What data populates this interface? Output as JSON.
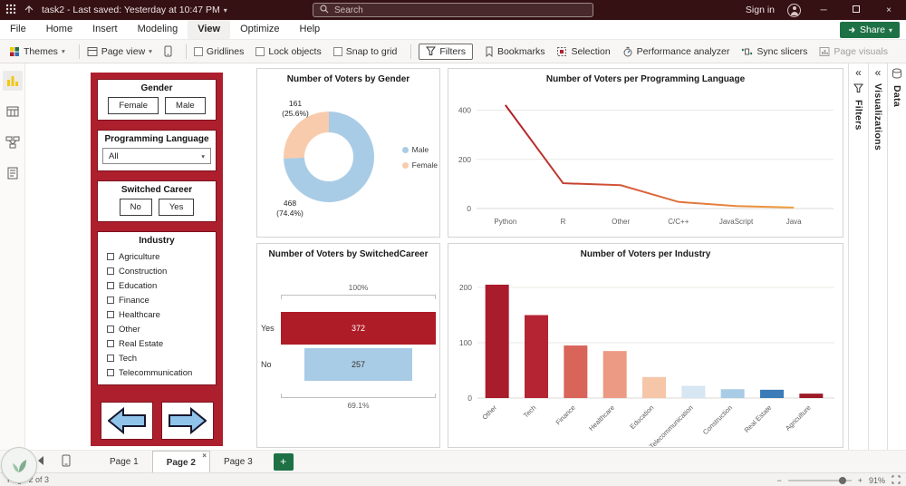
{
  "titlebar": {
    "title": "task2 - Last saved: Yesterday at 10:47 PM",
    "search_placeholder": "Search",
    "sign_in": "Sign in"
  },
  "menubar": {
    "items": [
      "File",
      "Home",
      "Insert",
      "Modeling",
      "View",
      "Optimize",
      "Help"
    ],
    "share": "Share"
  },
  "ribbon": {
    "themes": "Themes",
    "page_view": "Page view",
    "gridlines": "Gridlines",
    "lock_objects": "Lock objects",
    "snap_to_grid": "Snap to grid",
    "filters": "Filters",
    "bookmarks": "Bookmarks",
    "selection": "Selection",
    "performance_analyzer": "Performance analyzer",
    "sync_slicers": "Sync slicers",
    "page_visuals": "Page visuals"
  },
  "slicers": {
    "gender": {
      "title": "Gender",
      "options": [
        "Female",
        "Male"
      ]
    },
    "language": {
      "title": "Programming Language",
      "value": "All"
    },
    "switched": {
      "title": "Switched Career",
      "options": [
        "No",
        "Yes"
      ]
    },
    "industry": {
      "title": "Industry",
      "options": [
        "Agriculture",
        "Construction",
        "Education",
        "Finance",
        "Healthcare",
        "Other",
        "Real Estate",
        "Tech",
        "Telecommunication"
      ]
    }
  },
  "chart_data": [
    {
      "type": "pie",
      "title": "Number of Voters by Gender",
      "labels": [
        "Male",
        "Female"
      ],
      "values": [
        468,
        161
      ],
      "percent_labels": [
        "(74.4%)",
        "(25.6%)"
      ],
      "colors": [
        "#A9CCE6",
        "#F8CBAD"
      ],
      "legend_position": "right"
    },
    {
      "type": "line",
      "title": "Number of Voters per Programming Language",
      "categories": [
        "Python",
        "R",
        "Other",
        "C/C++",
        "JavaScript",
        "Java"
      ],
      "values": [
        421,
        103,
        95,
        27,
        10,
        4
      ],
      "ylim": [
        0,
        450
      ],
      "yticks": [
        0,
        200,
        400
      ],
      "line_colors": [
        "#B01E24",
        "#D95F3B",
        "#F2A03D"
      ]
    },
    {
      "type": "funnel",
      "title": "Number of Voters by SwitchedCareer",
      "categories": [
        "Yes",
        "No"
      ],
      "values": [
        372,
        257
      ],
      "colors": [
        "#AE1C28",
        "#A9CCE6"
      ],
      "top_label": "100%",
      "bottom_label": "69.1%"
    },
    {
      "type": "bar",
      "title": "Number of Voters per Industry",
      "categories": [
        "Other",
        "Tech",
        "Finance",
        "Healthcare",
        "Education",
        "Telecommunication",
        "Construction",
        "Real Estate",
        "Agriculture"
      ],
      "values": [
        205,
        150,
        95,
        85,
        38,
        22,
        16,
        15,
        8
      ],
      "colors": [
        "#A81C2C",
        "#B52433",
        "#D96459",
        "#EC9A83",
        "#F6C6A8",
        "#D6E6F2",
        "#A9CCE6",
        "#3B7CB8",
        "#9C1B28"
      ],
      "yticks": [
        0,
        100,
        200
      ],
      "ylim": [
        0,
        210
      ]
    }
  ],
  "right_panels": [
    "Filters",
    "Visualizations",
    "Data"
  ],
  "pages": {
    "tabs": [
      "Page 1",
      "Page 2",
      "Page 3"
    ],
    "active": "Page 2",
    "add": "+"
  },
  "statusbar": {
    "page_status": "Page 2 of 3",
    "zoom": "91%"
  }
}
